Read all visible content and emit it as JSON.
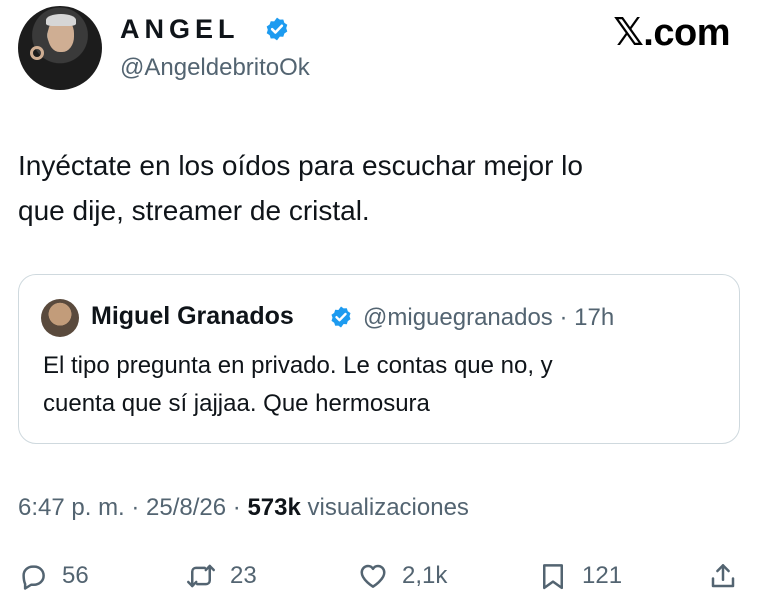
{
  "author": {
    "display_name": "ANGEL",
    "handle": "@AngeldebritoOk"
  },
  "brand": "𝕏.com",
  "tweet": {
    "text_line1": "Inyéctate en los oídos para escuchar mejor lo",
    "text_line2": "que dije, streamer de cristal."
  },
  "quoted": {
    "name": "Miguel Granados",
    "handle_time": "@miguegranados · 17h",
    "text_line1": "El tipo pregunta en privado. Le contas que no, y",
    "text_line2": "cuenta que sí jajjaa. Que hermosura"
  },
  "meta": {
    "time": "6:47 p. m. · 25/8/26 · ",
    "views_count": "573k",
    "views_label": " visualizaciones"
  },
  "actions": {
    "replies": "56",
    "reposts": "23",
    "likes": "2,1k",
    "bookmarks": "121"
  },
  "colors": {
    "verified": "#1d9bf0",
    "text": "#0f1419",
    "muted": "#536471",
    "border": "#cfd9de"
  }
}
